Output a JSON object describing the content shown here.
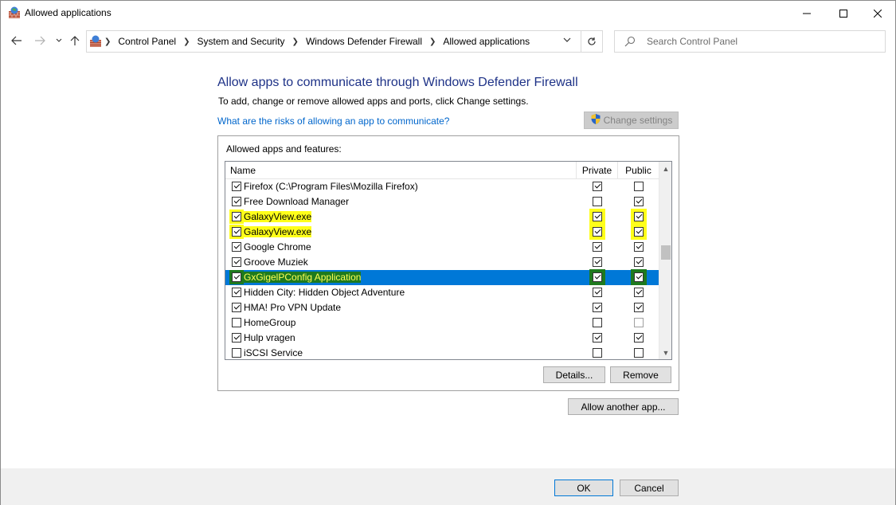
{
  "window": {
    "title": "Allowed applications"
  },
  "address_bar": {
    "crumbs": [
      "Control Panel",
      "System and Security",
      "Windows Defender Firewall",
      "Allowed applications"
    ]
  },
  "search": {
    "placeholder": "Search Control Panel"
  },
  "content": {
    "heading": "Allow apps to communicate through Windows Defender Firewall",
    "subtext": "To add, change or remove allowed apps and ports, click Change settings.",
    "risk_link": "What are the risks of allowing an app to communicate?",
    "change_settings": "Change settings"
  },
  "list": {
    "group_label": "Allowed apps and features:",
    "columns": {
      "name": "Name",
      "private": "Private",
      "public": "Public"
    },
    "rows": [
      {
        "name": "Firefox (C:\\Program Files\\Mozilla Firefox)",
        "enabled": true,
        "private": true,
        "public": false
      },
      {
        "name": "Free Download Manager",
        "enabled": true,
        "private": false,
        "public": true
      },
      {
        "name": "GalaxyView.exe",
        "enabled": true,
        "private": true,
        "public": true,
        "highlight": "yellow"
      },
      {
        "name": "GalaxyView.exe",
        "enabled": true,
        "private": true,
        "public": true,
        "highlight": "yellow"
      },
      {
        "name": "Google Chrome",
        "enabled": true,
        "private": true,
        "public": true
      },
      {
        "name": "Groove Muziek",
        "enabled": true,
        "private": true,
        "public": true
      },
      {
        "name": "GxGigelPConfig Application",
        "enabled": true,
        "private": true,
        "public": true,
        "selected": true,
        "highlight": "green"
      },
      {
        "name": "Hidden City: Hidden Object Adventure",
        "enabled": true,
        "private": true,
        "public": true
      },
      {
        "name": "HMA! Pro VPN Update",
        "enabled": true,
        "private": true,
        "public": true
      },
      {
        "name": "HomeGroup",
        "enabled": false,
        "private": false,
        "public": false
      },
      {
        "name": "Hulp vragen",
        "enabled": true,
        "private": true,
        "public": true
      },
      {
        "name": "iSCSI Service",
        "enabled": false,
        "private": false,
        "public": false
      }
    ]
  },
  "buttons": {
    "details": "Details...",
    "remove": "Remove",
    "allow_another": "Allow another app...",
    "ok": "OK",
    "cancel": "Cancel"
  },
  "colors": {
    "accent": "#0078d7",
    "heading": "#1e3287",
    "link": "#0066cc",
    "highlight_yellow": "#ffff1a",
    "highlight_green": "#1e7a1e"
  }
}
